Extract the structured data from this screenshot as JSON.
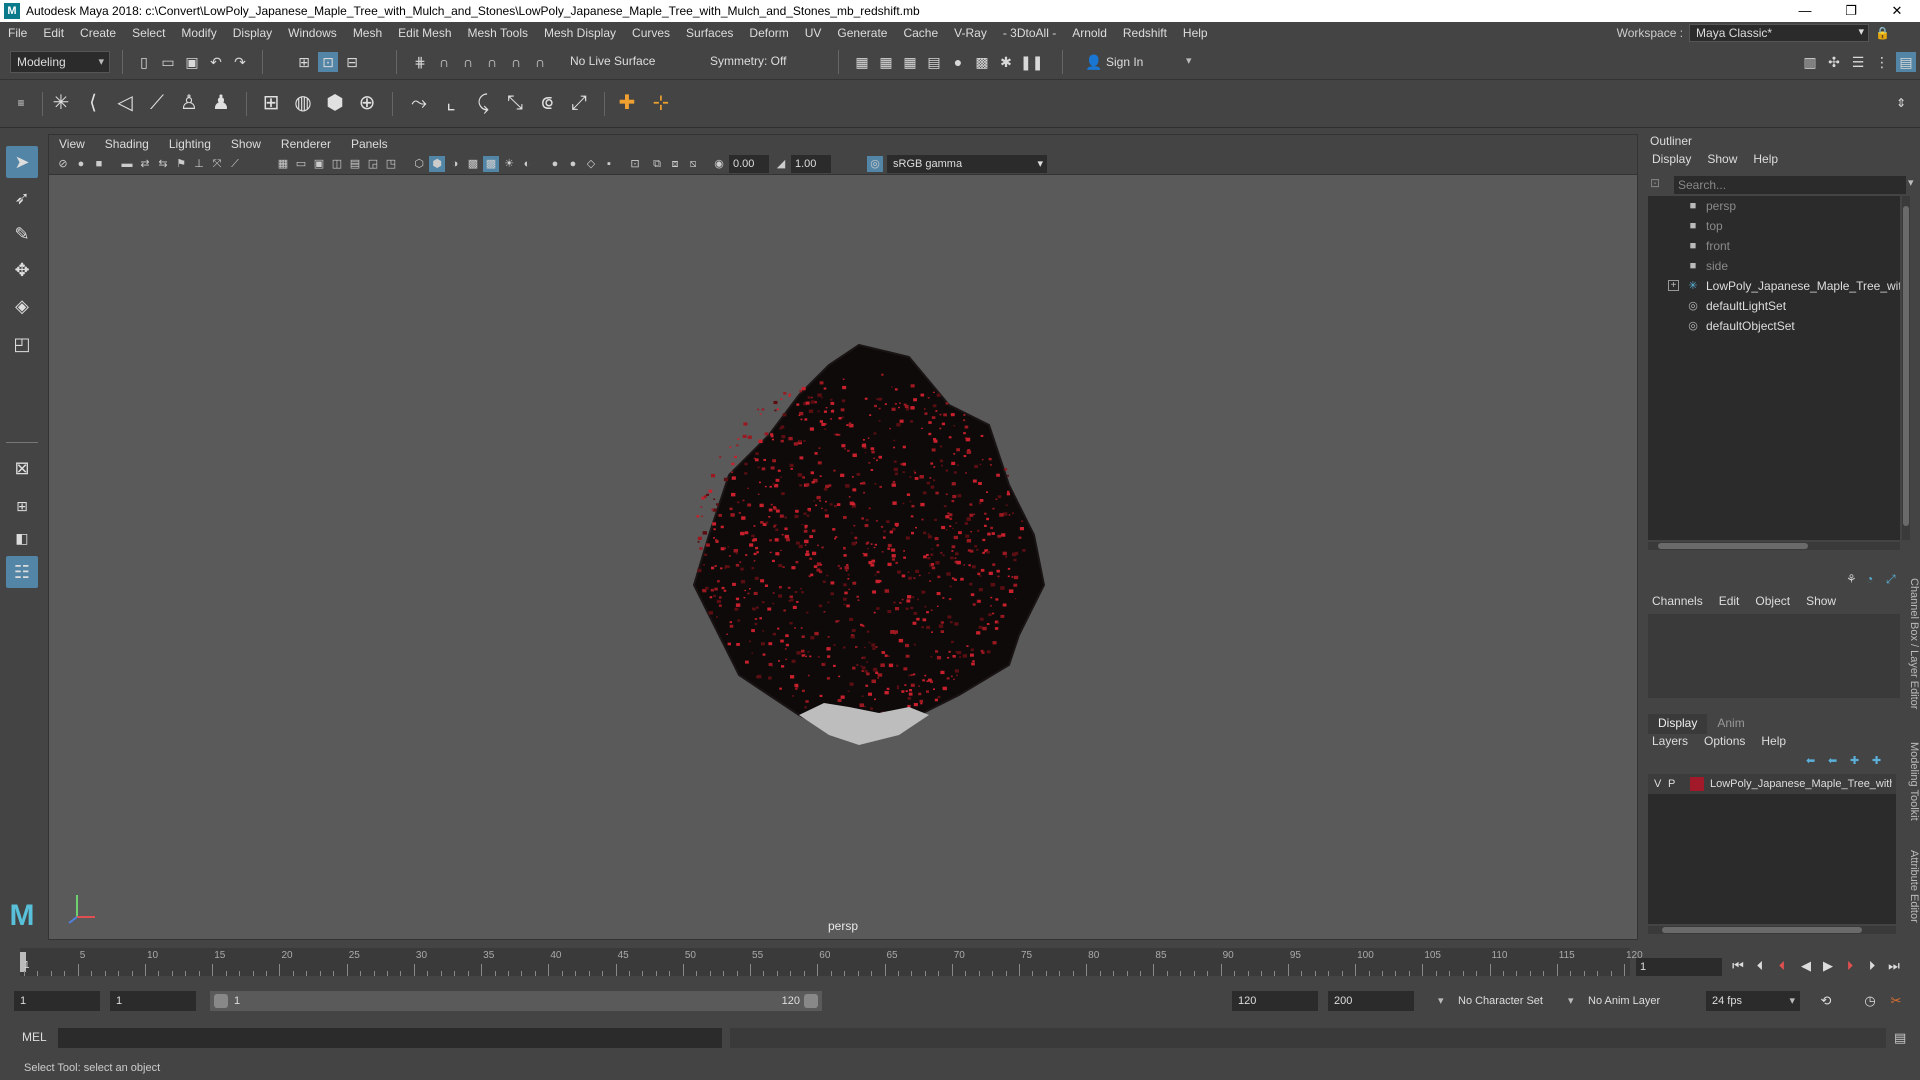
{
  "window": {
    "title": "Autodesk Maya 2018: c:\\Convert\\LowPoly_Japanese_Maple_Tree_with_Mulch_and_Stones\\LowPoly_Japanese_Maple_Tree_with_Mulch_and_Stones_mb_redshift.mb",
    "logo": "M",
    "minimize": "—",
    "maximize": "❐",
    "close": "✕"
  },
  "menubar": {
    "items": [
      "File",
      "Edit",
      "Create",
      "Select",
      "Modify",
      "Display",
      "Windows",
      "Mesh",
      "Edit Mesh",
      "Mesh Tools",
      "Mesh Display",
      "Curves",
      "Surfaces",
      "Deform",
      "UV",
      "Generate",
      "Cache",
      "V-Ray",
      "- 3DtoAll -",
      "Arnold",
      "Redshift",
      "Help"
    ],
    "workspace_label": "Workspace :",
    "workspace_value": "Maya Classic*"
  },
  "statusline": {
    "menuset": "Modeling",
    "live_surface": "No Live Surface",
    "symmetry": "Symmetry: Off",
    "sign_in": "Sign In"
  },
  "viewport": {
    "menus": [
      "View",
      "Shading",
      "Lighting",
      "Show",
      "Renderer",
      "Panels"
    ],
    "exposure": "0.00",
    "gamma_value": "1.00",
    "color_space": "sRGB gamma",
    "camera_label": "persp"
  },
  "outliner": {
    "title": "Outliner",
    "menus": [
      "Display",
      "Show",
      "Help"
    ],
    "search_placeholder": "Search...",
    "items": [
      {
        "label": "persp",
        "kind": "camera"
      },
      {
        "label": "top",
        "kind": "camera"
      },
      {
        "label": "front",
        "kind": "camera"
      },
      {
        "label": "side",
        "kind": "camera"
      },
      {
        "label": "LowPoly_Japanese_Maple_Tree_with_Mu",
        "kind": "group"
      },
      {
        "label": "defaultLightSet",
        "kind": "set"
      },
      {
        "label": "defaultObjectSet",
        "kind": "set"
      }
    ]
  },
  "channelbox": {
    "menus": [
      "Channels",
      "Edit",
      "Object",
      "Show"
    ]
  },
  "layers": {
    "tabs": [
      "Display",
      "Anim"
    ],
    "menus": [
      "Layers",
      "Options",
      "Help"
    ],
    "row": {
      "v": "V",
      "p": "P",
      "name": "LowPoly_Japanese_Maple_Tree_with_",
      "color": "#a21a2a"
    }
  },
  "side_tabs": [
    "Channel Box / Layer Editor",
    "Modeling Toolkit",
    "Attribute Editor"
  ],
  "timeslider": {
    "ticks": [
      5,
      10,
      15,
      20,
      25,
      30,
      35,
      40,
      45,
      50,
      55,
      60,
      65,
      70,
      75,
      80,
      85,
      90,
      95,
      100,
      105,
      110,
      115,
      120
    ],
    "start_marker": "1",
    "current_frame": "1"
  },
  "rangeslider": {
    "start": "1",
    "anim_start": "1",
    "range_start": "1",
    "range_end": "120",
    "anim_end": "120",
    "end": "200",
    "character_set": "No Character Set",
    "anim_layer": "No Anim Layer",
    "fps": "24 fps"
  },
  "cmdline": {
    "lang": "MEL"
  },
  "helpline": {
    "text": "Select Tool: select an object"
  },
  "colors": {
    "accent": "#5285a6",
    "bg": "#444444",
    "viewport": "#5a5a5a",
    "foliage_red": "#c8202c"
  }
}
